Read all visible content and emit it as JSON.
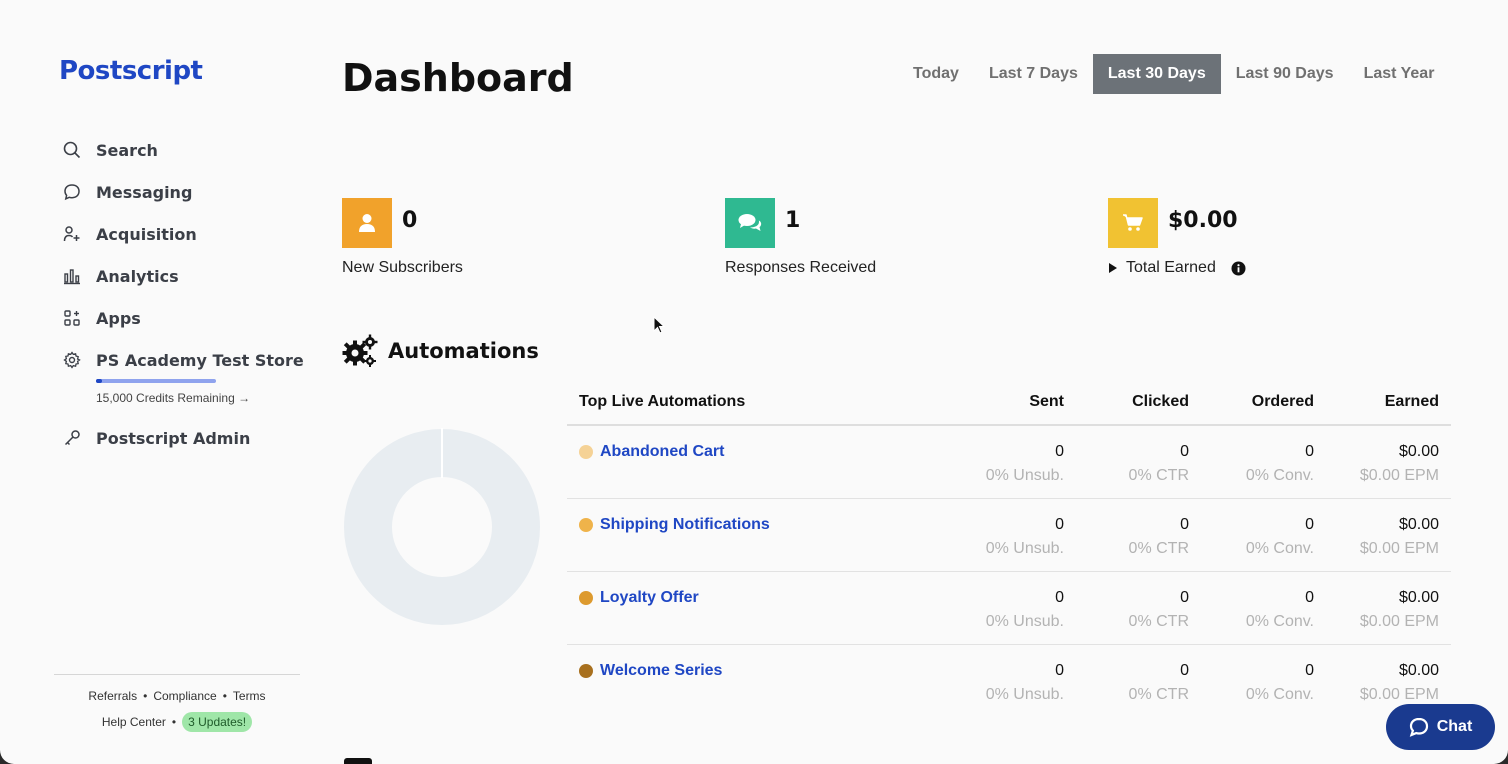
{
  "sidebar": {
    "logo": "Postscript",
    "items": [
      {
        "label": "Search",
        "icon": "search-icon"
      },
      {
        "label": "Messaging",
        "icon": "chat-bubble-icon"
      },
      {
        "label": "Acquisition",
        "icon": "user-plus-icon"
      },
      {
        "label": "Analytics",
        "icon": "bar-chart-icon"
      },
      {
        "label": "Apps",
        "icon": "apps-grid-icon"
      },
      {
        "label": "PS Academy Test Store",
        "icon": "gear-icon"
      },
      {
        "label": "Postscript Admin",
        "icon": "key-icon"
      }
    ],
    "credits": {
      "text": "15,000 Credits Remaining →",
      "fill_fraction": 0.05
    },
    "footer": {
      "referrals": "Referrals",
      "compliance": "Compliance",
      "terms": "Terms",
      "help_center": "Help Center",
      "updates_badge": "3 Updates!"
    }
  },
  "header": {
    "title": "Dashboard",
    "ranges": [
      "Today",
      "Last 7 Days",
      "Last 30 Days",
      "Last 90 Days",
      "Last Year"
    ],
    "active_range": "Last 30 Days"
  },
  "stats": [
    {
      "value": "0",
      "label": "New Subscribers",
      "icon": "user-icon",
      "color": "#f1a22b"
    },
    {
      "value": "1",
      "label": "Responses Received",
      "icon": "comments-icon",
      "color": "#2fb991"
    },
    {
      "value": "$0.00",
      "label": "Total Earned",
      "icon": "cart-icon",
      "color": "#f1c232"
    }
  ],
  "automations": {
    "title": "Automations",
    "columns": [
      "Top Live Automations",
      "Sent",
      "Clicked",
      "Ordered",
      "Earned"
    ],
    "rows": [
      {
        "name": "Abandoned Cart",
        "dot_color": "#f5d296",
        "sent": "0",
        "sent_sub": "0% Unsub.",
        "clicked": "0",
        "clicked_sub": "0% CTR",
        "ordered": "0",
        "ordered_sub": "0% Conv.",
        "earned": "$0.00",
        "earned_sub": "$0.00 EPM"
      },
      {
        "name": "Shipping Notifications",
        "dot_color": "#efb34a",
        "sent": "0",
        "sent_sub": "0% Unsub.",
        "clicked": "0",
        "clicked_sub": "0% CTR",
        "ordered": "0",
        "ordered_sub": "0% Conv.",
        "earned": "$0.00",
        "earned_sub": "$0.00 EPM"
      },
      {
        "name": "Loyalty Offer",
        "dot_color": "#dd9a2e",
        "sent": "0",
        "sent_sub": "0% Unsub.",
        "clicked": "0",
        "clicked_sub": "0% CTR",
        "ordered": "0",
        "ordered_sub": "0% Conv.",
        "earned": "$0.00",
        "earned_sub": "$0.00 EPM"
      },
      {
        "name": "Welcome Series",
        "dot_color": "#a8701e",
        "sent": "0",
        "sent_sub": "0% Unsub.",
        "clicked": "0",
        "clicked_sub": "0% CTR",
        "ordered": "0",
        "ordered_sub": "0% Conv.",
        "earned": "$0.00",
        "earned_sub": "$0.00 EPM"
      }
    ]
  },
  "chat": {
    "label": "Chat"
  }
}
